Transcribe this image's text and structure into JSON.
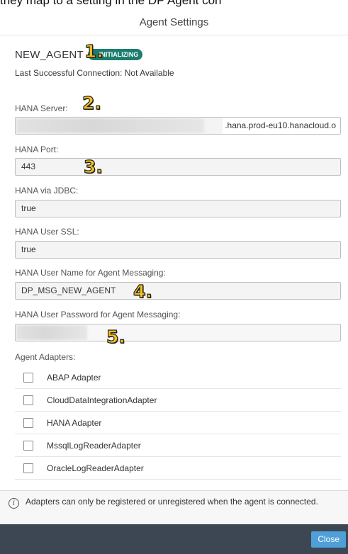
{
  "top_cut_text": "they map to a setting in the DP Agent con",
  "dialog": {
    "title": "Agent Settings",
    "agent_name": "NEW_AGENT",
    "status": "INITIALIZING",
    "last_connection": "Last Successful Connection: Not Available"
  },
  "fields": {
    "hana_server": {
      "label": "HANA Server:",
      "value_suffix": ".hana.prod-eu10.hanacloud.o"
    },
    "hana_port": {
      "label": "HANA Port:",
      "value": "443"
    },
    "hana_jdbc": {
      "label": "HANA via JDBC:",
      "value": "true"
    },
    "hana_ssl": {
      "label": "HANA User SSL:",
      "value": "true"
    },
    "hana_msg_user": {
      "label": "HANA User Name for Agent Messaging:",
      "value": "DP_MSG_NEW_AGENT"
    },
    "hana_msg_password": {
      "label": "HANA User Password for Agent Messaging:"
    }
  },
  "adapters": {
    "label": "Agent Adapters:",
    "items": [
      {
        "label": "ABAP Adapter",
        "checked": false
      },
      {
        "label": "CloudDataIntegrationAdapter",
        "checked": false
      },
      {
        "label": "HANA Adapter",
        "checked": false
      },
      {
        "label": "MssqlLogReaderAdapter",
        "checked": false
      },
      {
        "label": "OracleLogReaderAdapter",
        "checked": false
      }
    ]
  },
  "info": {
    "icon": "info-icon",
    "text": "Adapters can only be registered or unregistered when the agent is connected."
  },
  "footer": {
    "close_label": "Close"
  },
  "annotations": [
    "1.",
    "2.",
    "3.",
    "4.",
    "5."
  ],
  "colors": {
    "status_badge": "#1d7d6f",
    "footer_bg": "#3d4753",
    "close_button": "#4f9fd8",
    "annotation": "#f5c21b"
  }
}
